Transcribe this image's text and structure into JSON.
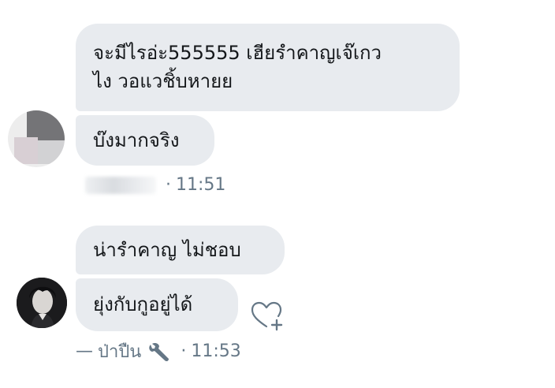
{
  "messages": [
    {
      "text_line1": "จะมีไรอ่ะ555555 เฮียรำคาญเจ๊เกว",
      "text_line2": "ไง วอแวชิ้บหายย"
    },
    {
      "text": "บ๊งมากจริง"
    },
    {
      "text": "น่ารำคาญ ไม่ชอบ"
    },
    {
      "text": "ยุ่งกับกูอยู่ได้"
    }
  ],
  "group1_meta": {
    "separator": "·",
    "time": "11:51"
  },
  "group2_meta": {
    "dash": "—",
    "sender": "ป่าปืน",
    "separator": "·",
    "time": "11:53"
  },
  "icons": {
    "react": "heart-plus-icon",
    "tool": "wrench-icon"
  },
  "colors": {
    "bubble": "#e8ebef",
    "meta_text": "#657786",
    "icon": "#657786"
  }
}
